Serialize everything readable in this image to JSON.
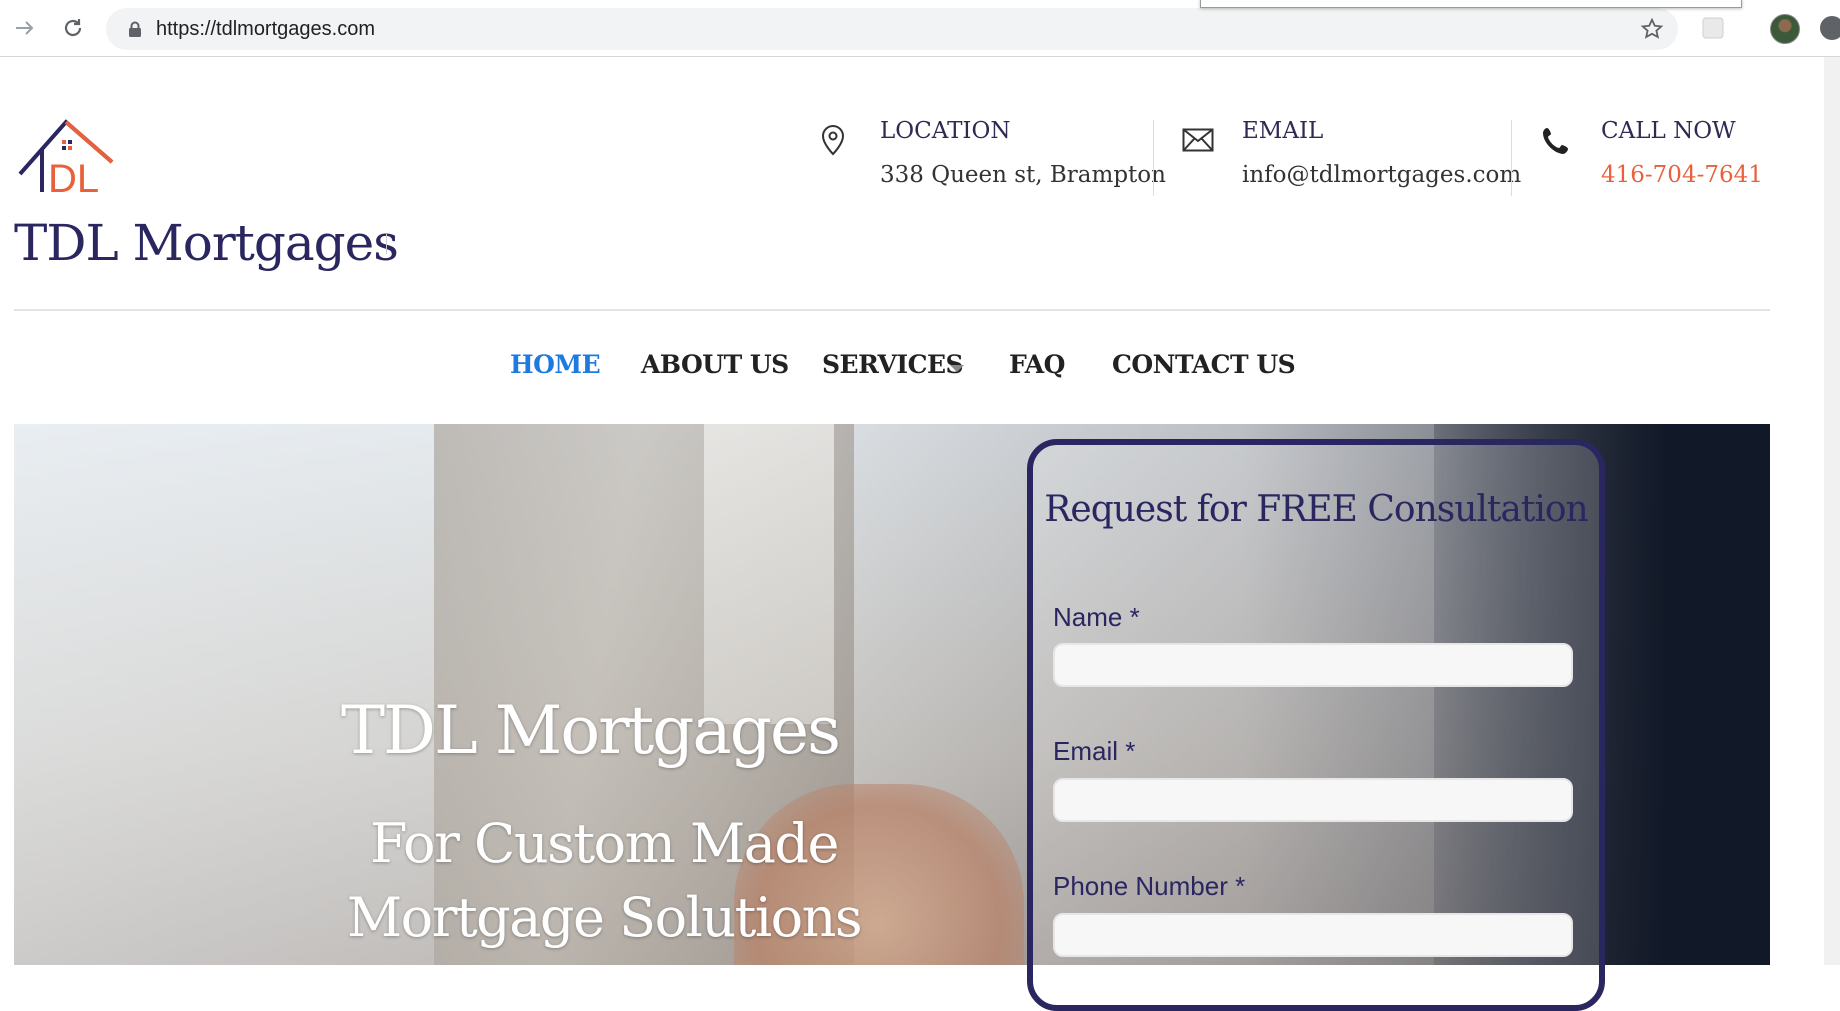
{
  "browser": {
    "url": "https://tdlmortgages.com",
    "back_icon": "arrow-right-icon",
    "reload_icon": "reload-icon",
    "lock_icon": "lock-icon",
    "bookmark_icon": "star-icon"
  },
  "header": {
    "brand": "TDL Mortgages",
    "logo_icon": "house-logo-icon",
    "location": {
      "label": "LOCATION",
      "value": "338 Queen st, Brampton",
      "icon": "map-pin-icon"
    },
    "email": {
      "label": "EMAIL",
      "value": "info@tdlmortgages.com",
      "icon": "envelope-icon"
    },
    "call": {
      "label": "CALL NOW",
      "value": "416-704-7641",
      "icon": "phone-icon"
    }
  },
  "nav": {
    "items": [
      {
        "label": "HOME",
        "active": true
      },
      {
        "label": "ABOUT US"
      },
      {
        "label": "SERVICES",
        "has_dropdown": true
      },
      {
        "label": "FAQ"
      },
      {
        "label": "CONTACT US"
      }
    ]
  },
  "hero": {
    "title": "TDL Mortgages",
    "subtitle": "For Custom Made Mortgage Solutions"
  },
  "form": {
    "title": "Request for FREE Consultation",
    "fields": [
      {
        "label": "Name *",
        "value": ""
      },
      {
        "label": "Email *",
        "value": ""
      },
      {
        "label": "Phone Number *",
        "value": ""
      }
    ]
  },
  "colors": {
    "brand_navy": "#2a2660",
    "accent_orange": "#e8613a",
    "nav_active": "#1e7ae0"
  }
}
